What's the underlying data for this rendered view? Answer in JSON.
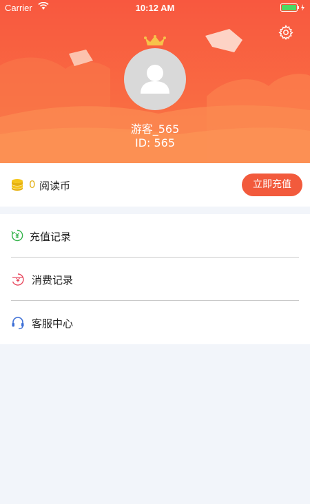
{
  "status_bar": {
    "carrier": "Carrier",
    "time": "10:12 AM"
  },
  "profile": {
    "username": "游客_565",
    "user_id": "ID: 565"
  },
  "wallet": {
    "coin_count": "0",
    "coin_label": "阅读币",
    "recharge_button": "立即充值"
  },
  "menu": {
    "items": [
      {
        "label": "充值记录",
        "icon": "recharge-record-icon"
      },
      {
        "label": "消费记录",
        "icon": "consumption-record-icon"
      },
      {
        "label": "客服中心",
        "icon": "headset-icon"
      }
    ]
  },
  "colors": {
    "header_red": "#f8583f",
    "accent_button": "#f25a3c",
    "coin_gold": "#e3b21b",
    "background": "#f2f5fa"
  }
}
